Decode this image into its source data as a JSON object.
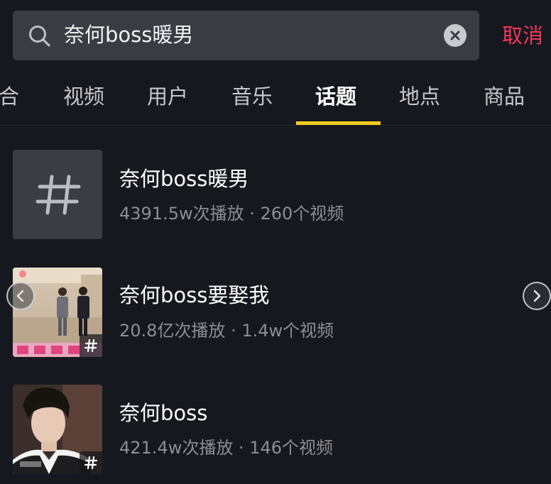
{
  "search": {
    "query": "奈何boss暖男",
    "cancel_label": "取消"
  },
  "tabs": [
    {
      "label": "合"
    },
    {
      "label": "视频"
    },
    {
      "label": "用户"
    },
    {
      "label": "音乐"
    },
    {
      "label": "话题"
    },
    {
      "label": "地点"
    },
    {
      "label": "商品"
    }
  ],
  "active_tab": "话题",
  "topics": [
    {
      "title": "奈何boss暖男",
      "meta": "4391.5w次播放 · 260个视频",
      "thumbnail": "hash-icon"
    },
    {
      "title": "奈何boss要娶我",
      "meta": "20.8亿次播放 · 1.4w个视频",
      "thumbnail": "drama-still-two-men-in-suits"
    },
    {
      "title": "奈何boss",
      "meta": "421.4w次播放 · 146个视频",
      "thumbnail": "portrait-young-man-in-suit"
    }
  ],
  "colors": {
    "background": "#16181f",
    "search_box": "#3a3c44",
    "cancel": "#f3355a",
    "tab_underline": "#f9cd1c",
    "meta_text": "#8d8e93"
  }
}
